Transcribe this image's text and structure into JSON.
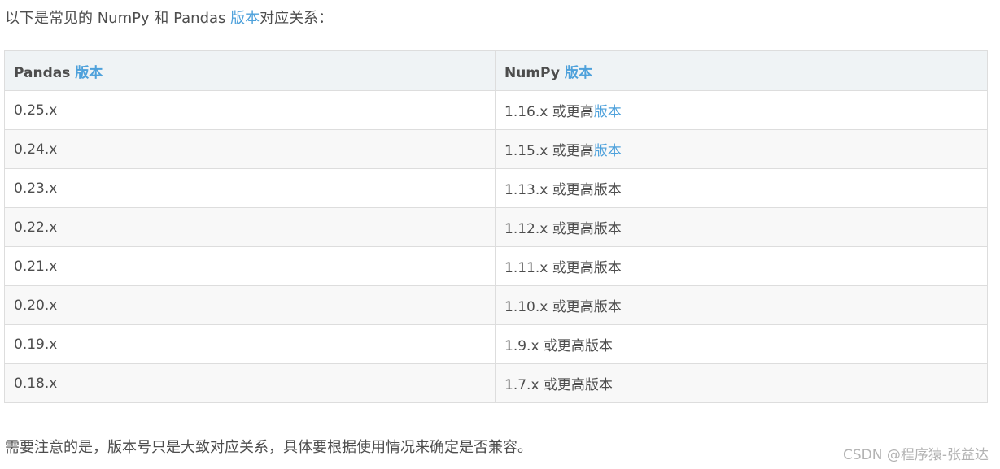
{
  "intro": {
    "prefix": "以下是常见的 NumPy 和 Pandas ",
    "link": "版本",
    "suffix": "对应关系："
  },
  "table": {
    "headers": [
      {
        "text": "Pandas ",
        "link": "版本"
      },
      {
        "text": "NumPy ",
        "link": "版本"
      }
    ],
    "rows": [
      {
        "pandas": "0.25.x",
        "numpy": "1.16.x 或更高",
        "numpy_link": "版本",
        "numpy_suffix": ""
      },
      {
        "pandas": "0.24.x",
        "numpy": "1.15.x 或更高",
        "numpy_link": "版本",
        "numpy_suffix": ""
      },
      {
        "pandas": "0.23.x",
        "numpy": "1.13.x 或更高版本",
        "numpy_link": "",
        "numpy_suffix": ""
      },
      {
        "pandas": "0.22.x",
        "numpy": "1.12.x 或更高版本",
        "numpy_link": "",
        "numpy_suffix": ""
      },
      {
        "pandas": "0.21.x",
        "numpy": "1.11.x 或更高版本",
        "numpy_link": "",
        "numpy_suffix": ""
      },
      {
        "pandas": "0.20.x",
        "numpy": "1.10.x 或更高版本",
        "numpy_link": "",
        "numpy_suffix": ""
      },
      {
        "pandas": "0.19.x",
        "numpy": "1.9.x 或更高版本",
        "numpy_link": "",
        "numpy_suffix": ""
      },
      {
        "pandas": "0.18.x",
        "numpy": "1.7.x 或更高版本",
        "numpy_link": "",
        "numpy_suffix": ""
      }
    ]
  },
  "note": "需要注意的是，版本号只是大致对应关系，具体要根据使用情况来确定是否兼容。",
  "watermark": "CSDN @程序猿-张益达",
  "colors": {
    "text": "#4d4d4d",
    "link": "#4ea1db",
    "header_bg": "#eff3f5",
    "alt_row_bg": "#f8f8f8",
    "border": "#dddddd",
    "watermark": "#b3b3b3"
  }
}
